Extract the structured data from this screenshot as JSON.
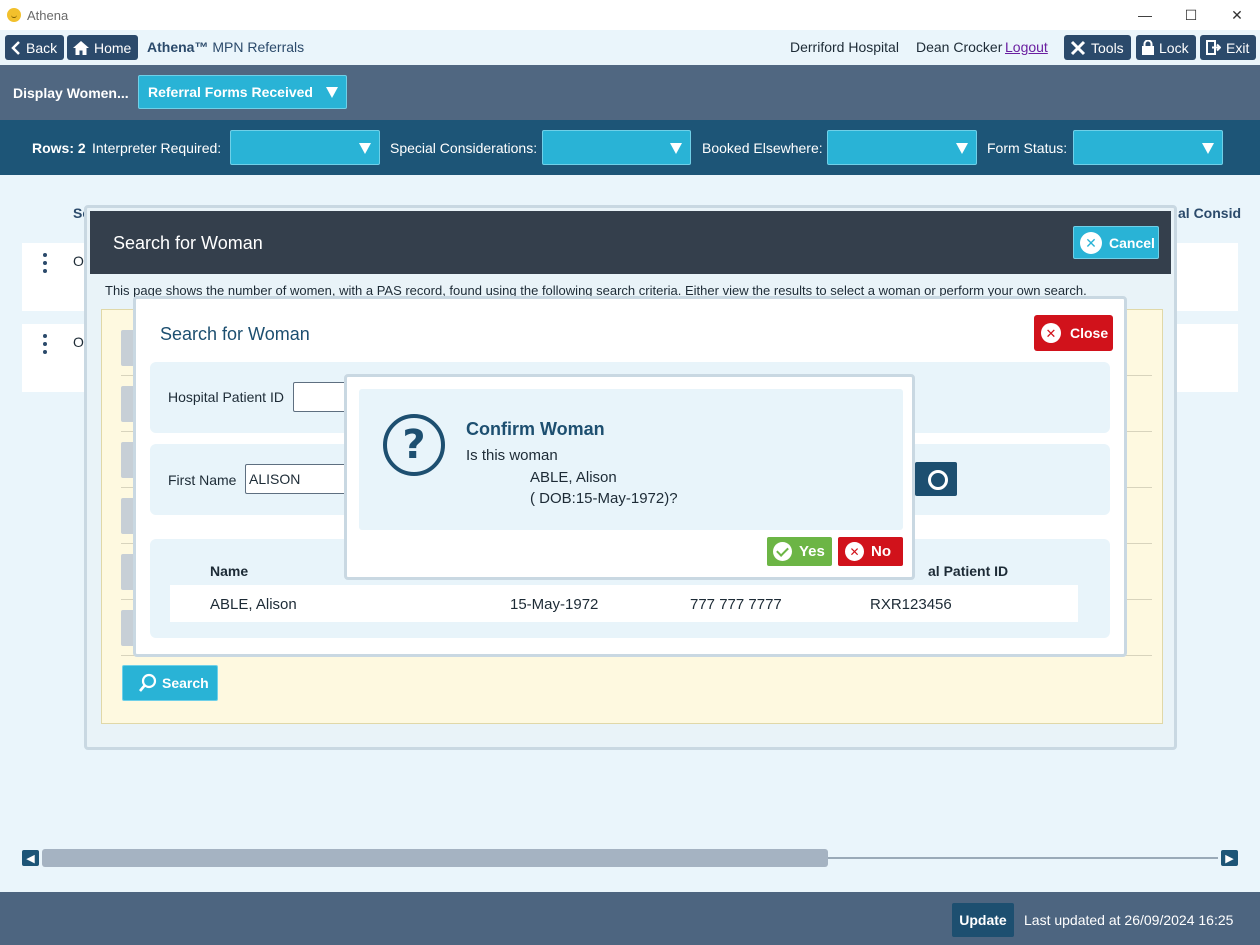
{
  "window": {
    "app_title": "Athena",
    "controls": {
      "minimize": "—",
      "maximize": "☐",
      "close": "✕"
    }
  },
  "nav": {
    "back_label": "Back",
    "home_label": "Home",
    "brand_name": "Athena™",
    "module_name": "MPN Referrals",
    "hospital": "Derriford Hospital",
    "user": "Dean Crocker",
    "logout_label": "Logout",
    "tools_label": "Tools",
    "lock_label": "Lock",
    "exit_label": "Exit"
  },
  "display_bar": {
    "label": "Display Women...",
    "selected": "Referral Forms Received"
  },
  "filters": {
    "rows_label": "Rows: 2",
    "interpreter_label": "Interpreter Required:",
    "interpreter_value": "",
    "special_label": "Special Considerations:",
    "special_value": "",
    "booked_label": "Booked Elsewhere:",
    "booked_value": "",
    "status_label": "Form Status:",
    "status_value": ""
  },
  "grid": {
    "header_left": "Sc",
    "header_right": "al Consid",
    "rows": [
      {
        "text": "Or"
      },
      {
        "text": "Or"
      }
    ]
  },
  "search_dialog": {
    "title": "Search for Woman",
    "cancel_label": "Cancel",
    "description": "This page shows the number of women, with a PAS record, found using the following search criteria. Either view the results to select a woman or perform your own search.",
    "search_label": "Search"
  },
  "inner_dialog": {
    "title": "Search for Woman",
    "close_label": "Close",
    "hospital_id_label": "Hospital Patient ID",
    "hospital_id_value": "",
    "first_name_label": "First Name",
    "first_name_value": "ALISON",
    "results": {
      "headers": {
        "name": "Name",
        "hospital_id": "al Patient ID"
      },
      "row": {
        "name": "ABLE, Alison",
        "dob": "15-May-1972",
        "nhs": "777 777 7777",
        "hospital_id": "RXR123456"
      }
    }
  },
  "confirm_dialog": {
    "title": "Confirm Woman",
    "line1": "Is this woman",
    "line2": "ABLE, Alison",
    "line3": "( DOB:15-May-1972)?",
    "yes_label": "Yes",
    "no_label": "No"
  },
  "footer": {
    "update_label": "Update",
    "last_updated": "Last updated at 26/09/2024 16:25"
  },
  "colors": {
    "brand_dark": "#2b4a6b",
    "accent": "#29b3d6",
    "danger": "#d1121b",
    "success": "#6cb545"
  }
}
